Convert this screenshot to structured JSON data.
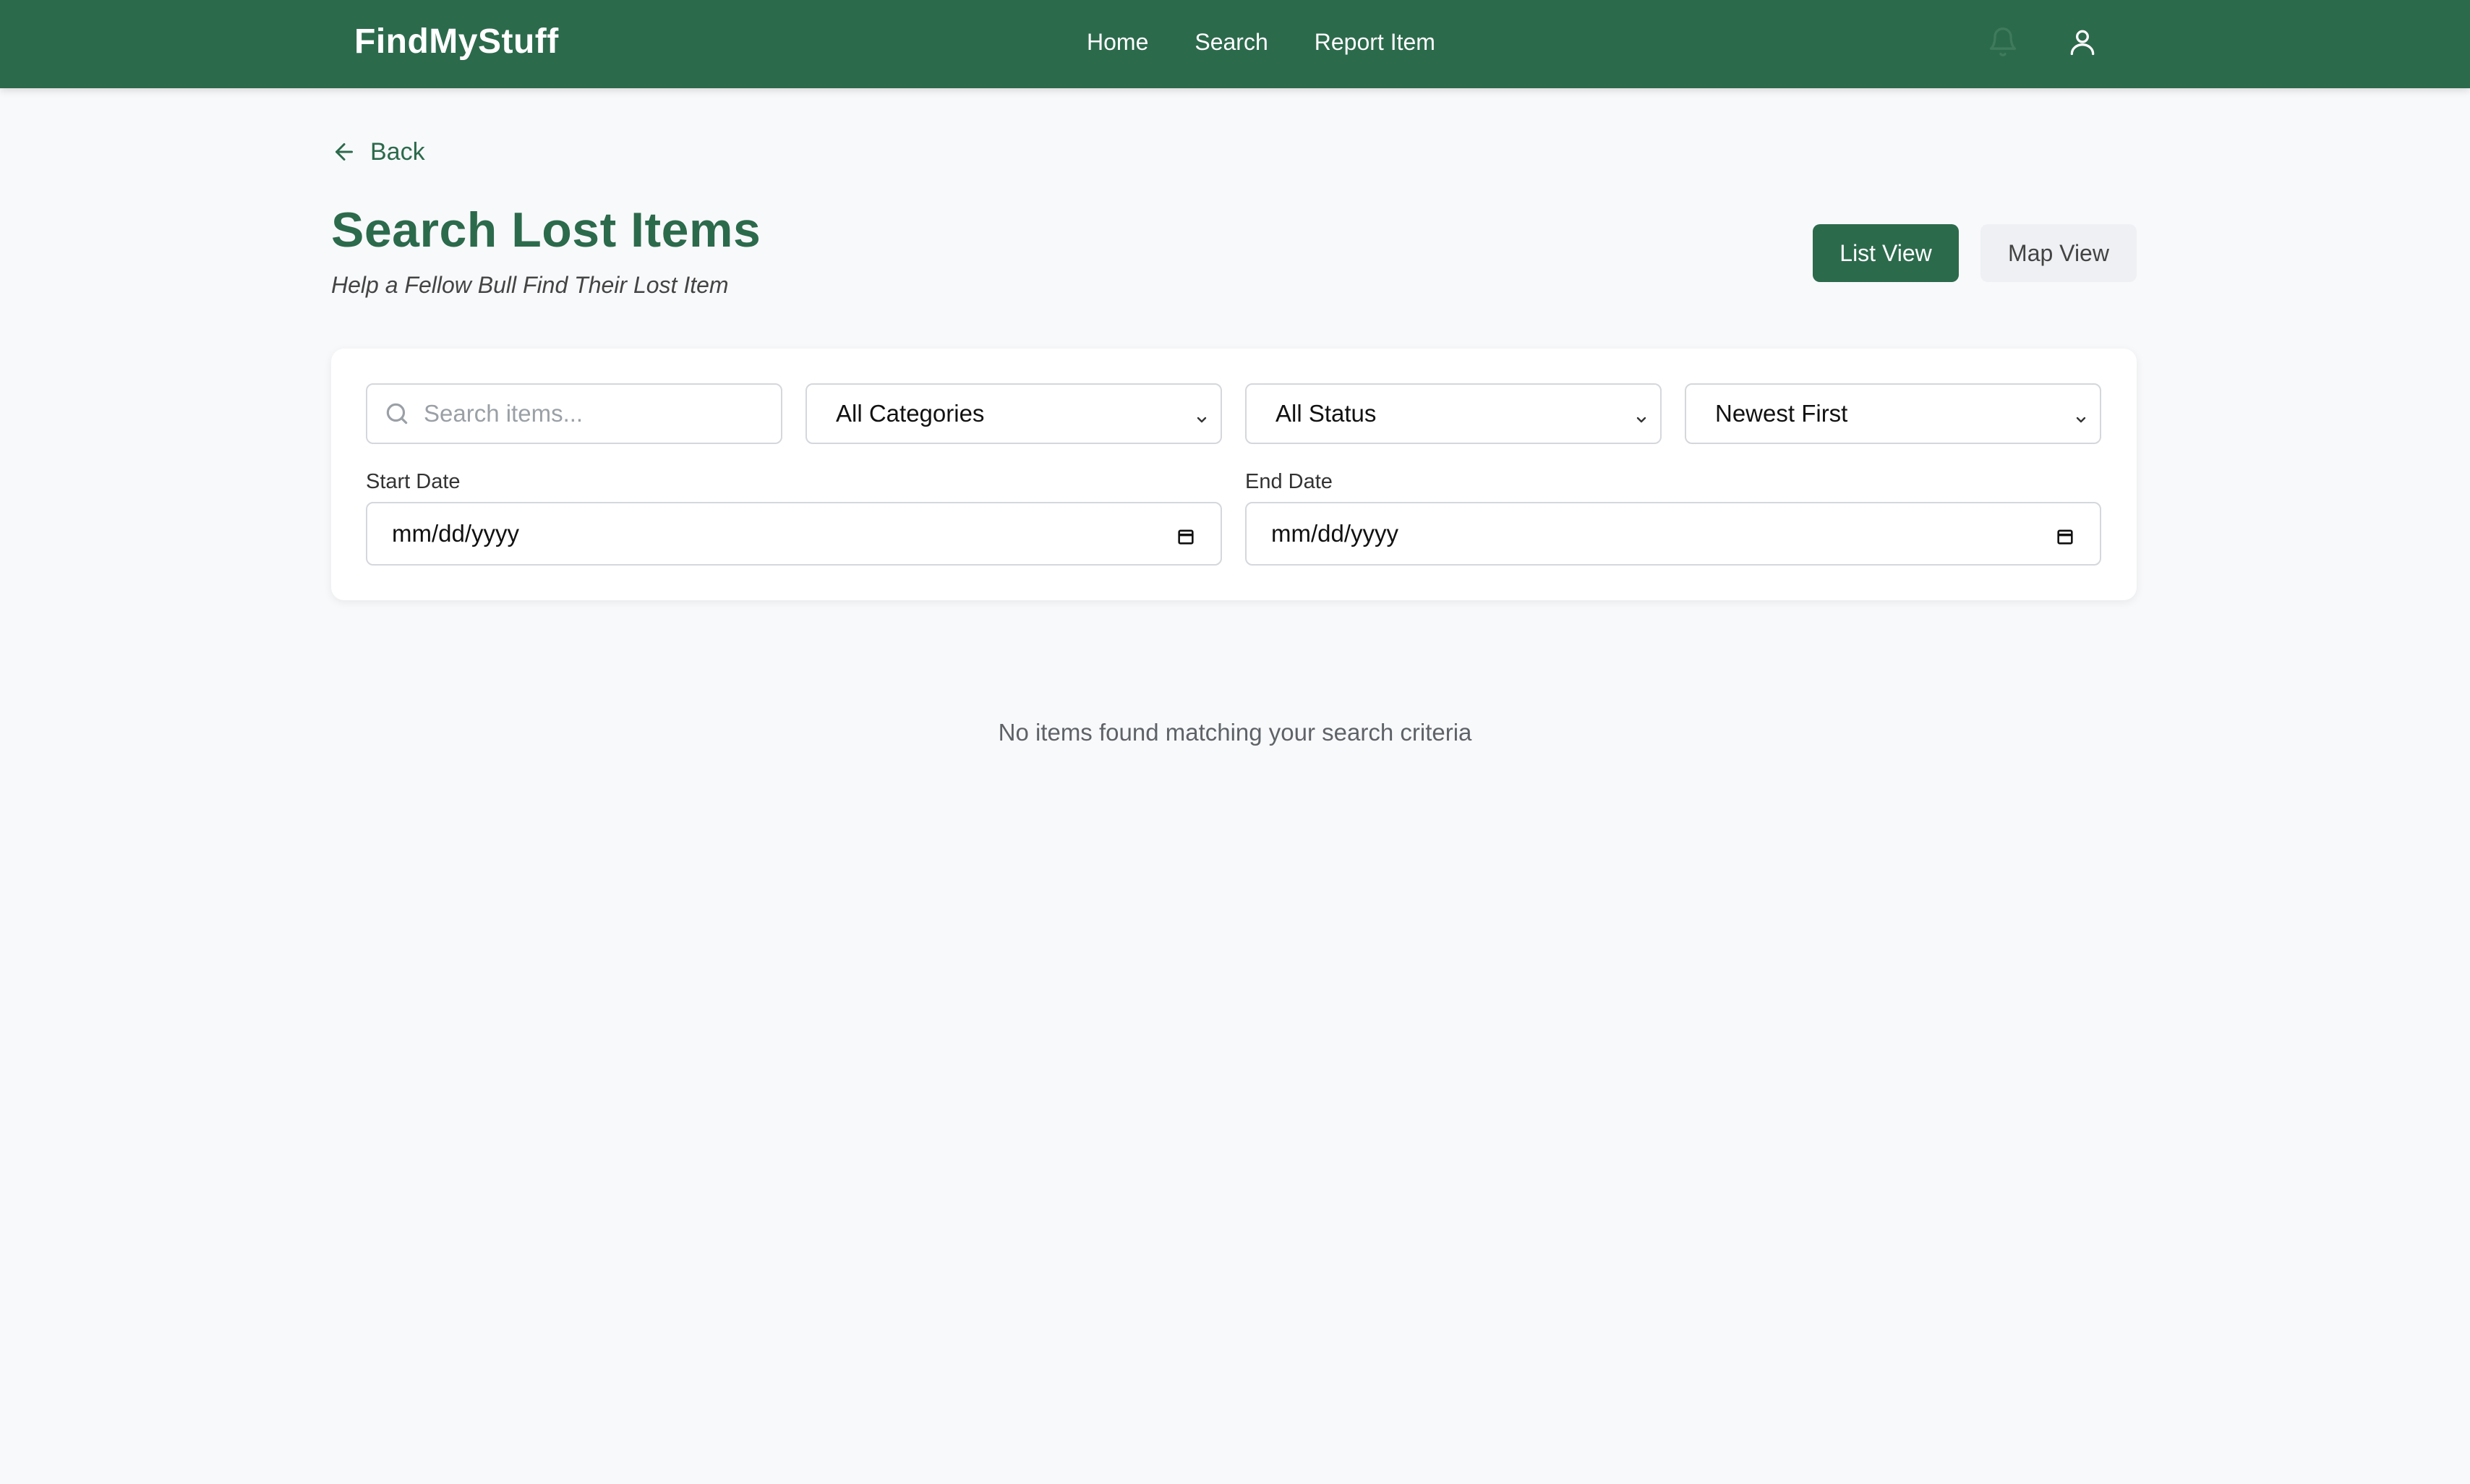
{
  "nav": {
    "brand": "FindMyStuff",
    "links": [
      "Home",
      "Search",
      "Report Item"
    ],
    "icons": [
      "bell-icon",
      "user-icon"
    ]
  },
  "back": {
    "label": "Back"
  },
  "header": {
    "title": "Search Lost Items",
    "subtitle": "Help a Fellow Bull Find Their Lost Item"
  },
  "views": {
    "list_label": "List View",
    "map_label": "Map View",
    "active": "List View"
  },
  "filters": {
    "search_placeholder": "Search items...",
    "category": "All Categories",
    "status": "All Status",
    "sort": "Newest First",
    "start_label": "Start Date",
    "end_label": "End Date",
    "start_value": "mm/dd/yyyy",
    "end_value": "mm/dd/yyyy"
  },
  "results": {
    "empty_message": "No items found matching your search criteria"
  },
  "colors": {
    "brand": "#2c6a4c",
    "background": "#f8f9fb",
    "muted_text": "#5f6368"
  }
}
